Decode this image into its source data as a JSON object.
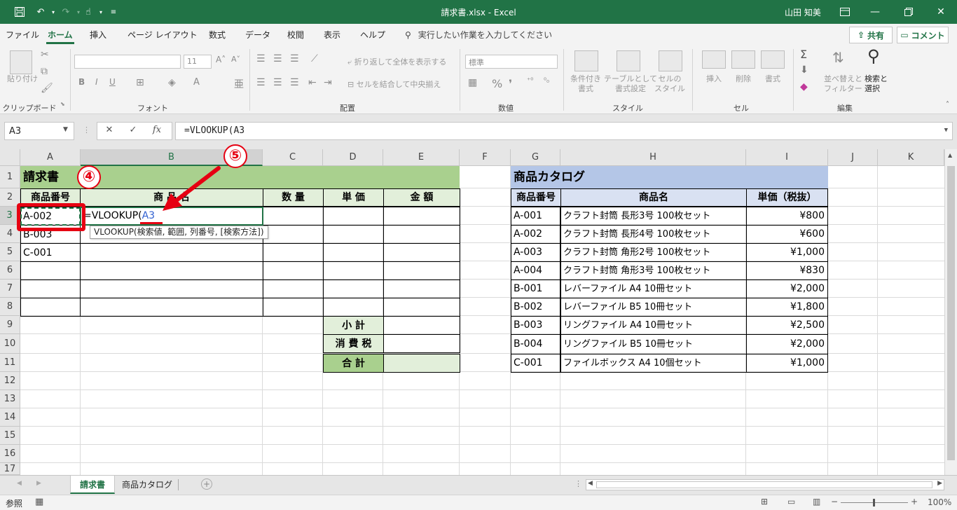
{
  "titlebar": {
    "title": "請求書.xlsx  -  Excel",
    "user": "山田 知美"
  },
  "ribbon_tabs": [
    "ファイル",
    "ホーム",
    "挿入",
    "ページ レイアウト",
    "数式",
    "データ",
    "校閲",
    "表示",
    "ヘルプ"
  ],
  "tell_me": "実行したい作業を入力してください",
  "share_label": "共有",
  "comment_label": "コメント",
  "ribbon": {
    "clipboard": {
      "paste": "貼り付け",
      "label": "クリップボード"
    },
    "font": {
      "size": "11",
      "label": "フォント"
    },
    "alignment": {
      "wrap": "折り返して全体を表示する",
      "merge": "セルを結合して中央揃え",
      "label": "配置"
    },
    "number": {
      "format": "標準",
      "label": "数値"
    },
    "styles": {
      "conditional": "条件付き\n書式",
      "table": "テーブルとして\n書式設定",
      "cellstyle": "セルの\nスタイル",
      "label": "スタイル"
    },
    "cells": {
      "insert": "挿入",
      "delete": "削除",
      "format": "書式",
      "label": "セル"
    },
    "editing": {
      "sort": "並べ替えと\nフィルター",
      "find": "検索と\n選択",
      "label": "編集"
    }
  },
  "formula_bar": {
    "name_box": "A3",
    "formula": "=VLOOKUP(A3"
  },
  "columns": [
    "A",
    "B",
    "C",
    "D",
    "E",
    "F",
    "G",
    "H",
    "I",
    "J",
    "K"
  ],
  "rows": [
    "1",
    "2",
    "3",
    "4",
    "5",
    "6",
    "7",
    "8",
    "9",
    "10",
    "11",
    "12",
    "13",
    "14",
    "15",
    "16",
    "17"
  ],
  "invoice": {
    "title": "請求書",
    "headers": [
      "商品番号",
      "商 品 名",
      "数 量",
      "単 価",
      "金 額"
    ],
    "codes": [
      "A-002",
      "B-003",
      "C-001"
    ],
    "editing_formula_prefix": "=VLOOKUP(",
    "editing_formula_ref": "A3",
    "tooltip": "VLOOKUP(検索値, 範囲, 列番号, [検索方法])",
    "subtotal_label": "小 計",
    "tax_label": "消 費 税",
    "total_label": "合 計"
  },
  "catalog": {
    "title": "商品カタログ",
    "headers": [
      "商品番号",
      "商品名",
      "単価（税抜）"
    ],
    "rows": [
      {
        "code": "A-001",
        "name": "クラフト封筒 長形3号 100枚セット",
        "price": "¥800"
      },
      {
        "code": "A-002",
        "name": "クラフト封筒 長形4号 100枚セット",
        "price": "¥600"
      },
      {
        "code": "A-003",
        "name": "クラフト封筒 角形2号 100枚セット",
        "price": "¥1,000"
      },
      {
        "code": "A-004",
        "name": "クラフト封筒 角形3号 100枚セット",
        "price": "¥830"
      },
      {
        "code": "B-001",
        "name": "レバーファイル A4 10冊セット",
        "price": "¥2,000"
      },
      {
        "code": "B-002",
        "name": "レバーファイル B5 10冊セット",
        "price": "¥1,800"
      },
      {
        "code": "B-003",
        "name": "リングファイル A4 10冊セット",
        "price": "¥2,500"
      },
      {
        "code": "B-004",
        "name": "リングファイル B5 10冊セット",
        "price": "¥2,000"
      },
      {
        "code": "C-001",
        "name": "ファイルボックス A4 10個セット",
        "price": "¥1,000"
      }
    ]
  },
  "annotations": {
    "step4": "④",
    "step5": "⑤"
  },
  "sheets": [
    "請求書",
    "商品カタログ"
  ],
  "status": {
    "mode": "参照",
    "zoom": "100%"
  },
  "colors": {
    "excel_green": "#217346",
    "invoice_header": "#a9d08e",
    "invoice_subheader": "#e2efda",
    "catalog_header": "#b4c6e7",
    "catalog_subheader": "#d9e1f2",
    "annotation_red": "#e60012",
    "ref_blue": "#2f5fd0"
  }
}
